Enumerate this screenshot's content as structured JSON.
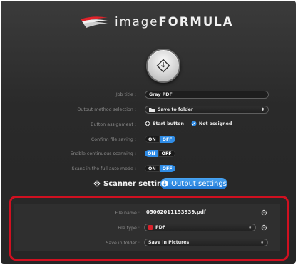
{
  "app": {
    "logo_text_light": "image",
    "logo_text_bold": "FORMULA"
  },
  "start_button": {
    "icon": "diamond-start-icon"
  },
  "job_settings": {
    "job_title_label": "Job title :",
    "job_title_value": "Gray PDF",
    "output_method_label": "Output method selection :",
    "output_method_value": "Save to folder",
    "button_assignment_label": "Button assignment :",
    "start_button_option": "Start button",
    "not_assigned_option": "Not assigned",
    "confirm_file_saving_label": "Confirm file saving :",
    "continuous_scanning_label": "Enable continuous scanning :",
    "full_auto_mode_label": "Scans in the full auto mode :",
    "toggle_on": "ON",
    "toggle_off": "OFF"
  },
  "tabs": {
    "scanner_settings": "Scanner setting",
    "output_settings": "Output settings"
  },
  "output_panel": {
    "file_name_label": "File name :",
    "file_name_value": "05062011153939.pdf",
    "file_type_label": "File type :",
    "file_type_value": "PDF",
    "save_in_folder_label": "Save in folder :",
    "save_in_folder_value": "Save in Pictures"
  },
  "colors": {
    "accent_blue": "#2f8ce6",
    "highlight_red": "#d01020",
    "background": "#2a2a2a"
  }
}
